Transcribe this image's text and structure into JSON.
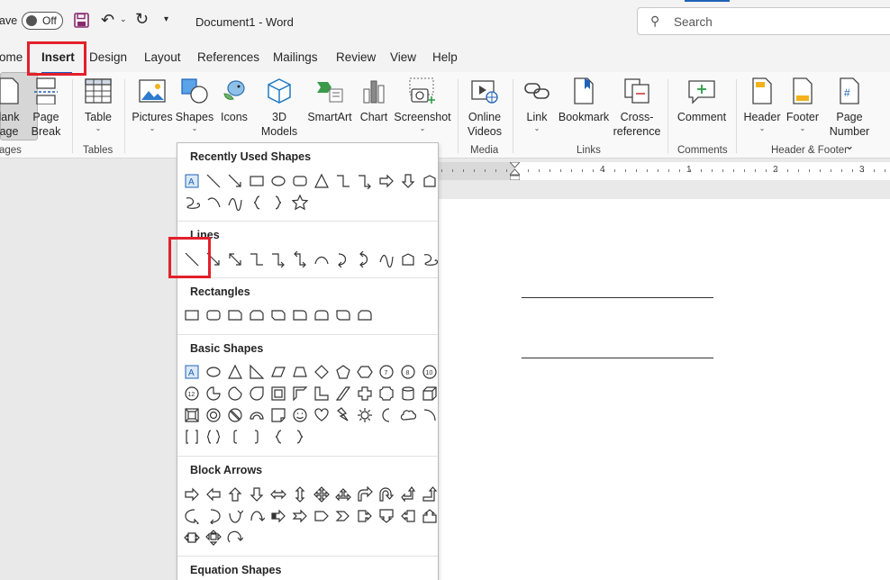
{
  "titlebar": {
    "autosave_label": "ave",
    "toggle_text": "Off",
    "doc_title": "Document1  -  Word",
    "search_placeholder": "Search"
  },
  "tabs": [
    "ome",
    "Insert",
    "Design",
    "Layout",
    "References",
    "Mailings",
    "Review",
    "View",
    "Help"
  ],
  "ribbon": {
    "blank_page": [
      "lank",
      "age"
    ],
    "page_break": [
      "Page",
      "Break"
    ],
    "table": "Table",
    "pictures": "Pictures",
    "shapes": "Shapes",
    "icons": "Icons",
    "models": [
      "3D",
      "Models"
    ],
    "smartart": "SmartArt",
    "chart": "Chart",
    "screenshot": "Screenshot",
    "online_videos": [
      "Online",
      "Videos"
    ],
    "link": "Link",
    "bookmark": "Bookmark",
    "cross_reference": [
      "Cross-",
      "reference"
    ],
    "comment": "Comment",
    "header": "Header",
    "footer": "Footer",
    "page_number": [
      "Page",
      "Number"
    ],
    "groups": {
      "pages": "ages",
      "tables": "Tables",
      "media": "Media",
      "links": "Links",
      "comments": "Comments",
      "header_footer": "Header & Footer"
    }
  },
  "ruler_numbers": [
    "1",
    "2",
    "3",
    "4"
  ],
  "dropdown": {
    "sections": [
      "Recently Used Shapes",
      "Lines",
      "Rectangles",
      "Basic Shapes",
      "Block Arrows",
      "Equation Shapes"
    ]
  },
  "colors": {
    "accent": "#185abd",
    "highlight": "#e3202c"
  }
}
